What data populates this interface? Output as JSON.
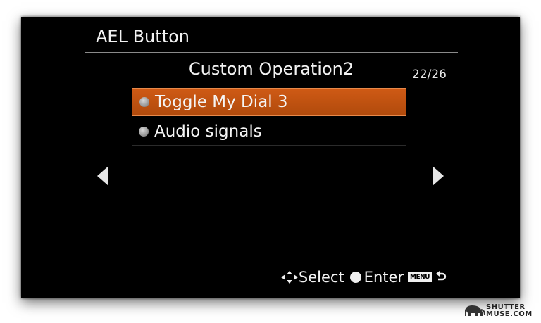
{
  "header": {
    "title": "AEL Button"
  },
  "menu": {
    "subtitle": "Custom Operation2",
    "page": "22/26",
    "options": [
      {
        "label": "Toggle My Dial 3",
        "selected": true
      },
      {
        "label": "Audio signals",
        "selected": false
      }
    ]
  },
  "footer": {
    "select_label": "Select",
    "enter_label": "Enter",
    "menu_key_label": "MENU"
  },
  "watermark": {
    "line1": "SHUTTER",
    "line2": "MUSE.COM"
  },
  "colors": {
    "highlight": "#c8530f",
    "screen_bg": "#000000",
    "text": "#f2f2f2"
  },
  "icons": {
    "prev": "arrow-left-icon",
    "next": "arrow-right-icon",
    "select": "four-way-arrows-icon",
    "enter": "center-button-icon",
    "back": "return-arrow-icon"
  }
}
